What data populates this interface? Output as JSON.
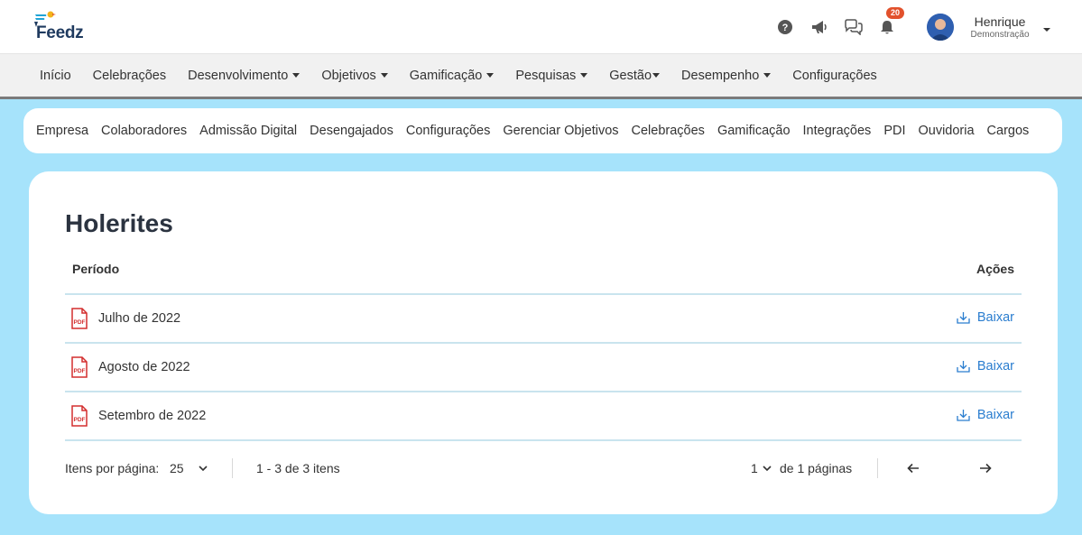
{
  "header": {
    "brand": "Feedz",
    "notifications_count": "20",
    "user": {
      "name": "Henrique",
      "role": "Demonstração"
    },
    "icons": [
      "help-icon",
      "megaphone-icon",
      "chat-icon",
      "bell-icon"
    ]
  },
  "main_nav": {
    "items": [
      {
        "label": "Início",
        "dropdown": false
      },
      {
        "label": "Celebrações",
        "dropdown": false
      },
      {
        "label": "Desenvolvimento",
        "dropdown": true
      },
      {
        "label": "Objetivos",
        "dropdown": true
      },
      {
        "label": "Gamificação",
        "dropdown": true
      },
      {
        "label": "Pesquisas",
        "dropdown": true
      },
      {
        "label": "Gestão",
        "dropdown": true
      },
      {
        "label": "Desempenho",
        "dropdown": true
      },
      {
        "label": "Configurações",
        "dropdown": false
      }
    ]
  },
  "sub_nav": {
    "items": [
      "Empresa",
      "Colaboradores",
      "Admissão Digital",
      "Desengajados",
      "Configurações",
      "Gerenciar Objetivos",
      "Celebrações",
      "Gamificação",
      "Integrações",
      "PDI",
      "Ouvidoria",
      "Cargos"
    ]
  },
  "payslips": {
    "title": "Holerites",
    "columns": {
      "period": "Período",
      "actions": "Ações"
    },
    "rows": [
      {
        "period": "Julho de 2022",
        "action": "Baixar"
      },
      {
        "period": "Agosto de 2022",
        "action": "Baixar"
      },
      {
        "period": "Setembro de 2022",
        "action": "Baixar"
      }
    ],
    "pagination": {
      "per_page_label": "Itens por página:",
      "per_page_value": "25",
      "range_text": "1 - 3 de 3 itens",
      "current_page": "1",
      "pages_text": "de 1 páginas"
    }
  },
  "colors": {
    "background": "#a6e3fb",
    "link": "#2a7dcf",
    "badge": "#e2512c",
    "pdf_red": "#d32f2f"
  }
}
